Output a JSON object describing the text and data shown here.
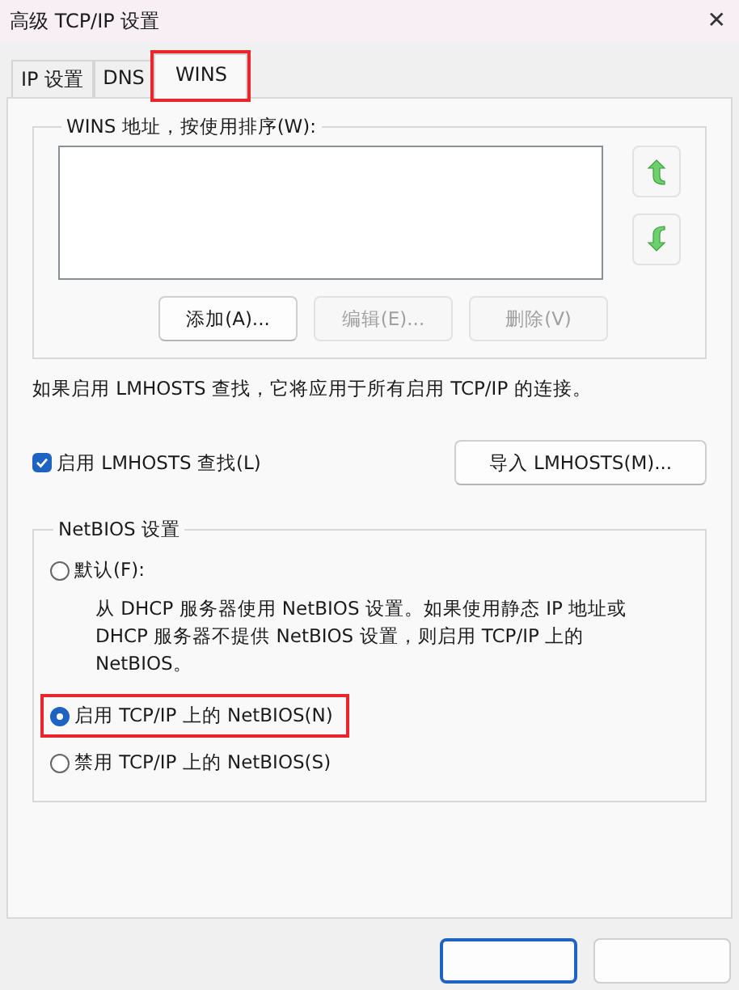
{
  "window": {
    "title": "高级 TCP/IP 设置",
    "close": "✕"
  },
  "tabs": [
    {
      "label": "IP 设置",
      "selected": false,
      "highlighted": false
    },
    {
      "label": "DNS",
      "selected": false,
      "highlighted": false
    },
    {
      "label": "WINS",
      "selected": true,
      "highlighted": true
    }
  ],
  "wins_group": {
    "title": "WINS 地址，按使用排序(W):",
    "buttons": [
      {
        "label": "添加(A)...",
        "disabled": false
      },
      {
        "label": "编辑(E)...",
        "disabled": true
      },
      {
        "label": "删除(V)",
        "disabled": true
      }
    ]
  },
  "lmhosts_note": "如果启用 LMHOSTS 查找，它将应用于所有启用 TCP/IP 的连接。",
  "lmhosts_checkbox": {
    "label": "启用 LMHOSTS 查找(L)",
    "checked": true
  },
  "import_button": "导入 LMHOSTS(M)...",
  "netbios_group": {
    "title": "NetBIOS 设置",
    "options": [
      {
        "label": "默认(F):",
        "selected": false,
        "highlighted": false,
        "description": "从 DHCP 服务器使用 NetBIOS 设置。如果使用静态 IP 地址或 DHCP 服务器不提供 NetBIOS 设置，则启用 TCP/IP 上的 NetBIOS。"
      },
      {
        "label": "启用 TCP/IP 上的 NetBIOS(N)",
        "selected": true,
        "highlighted": true
      },
      {
        "label": "禁用 TCP/IP 上的 NetBIOS(S)",
        "selected": false,
        "highlighted": false
      }
    ]
  },
  "footer_buttons": [
    {
      "default": true
    },
    {
      "default": false
    }
  ]
}
